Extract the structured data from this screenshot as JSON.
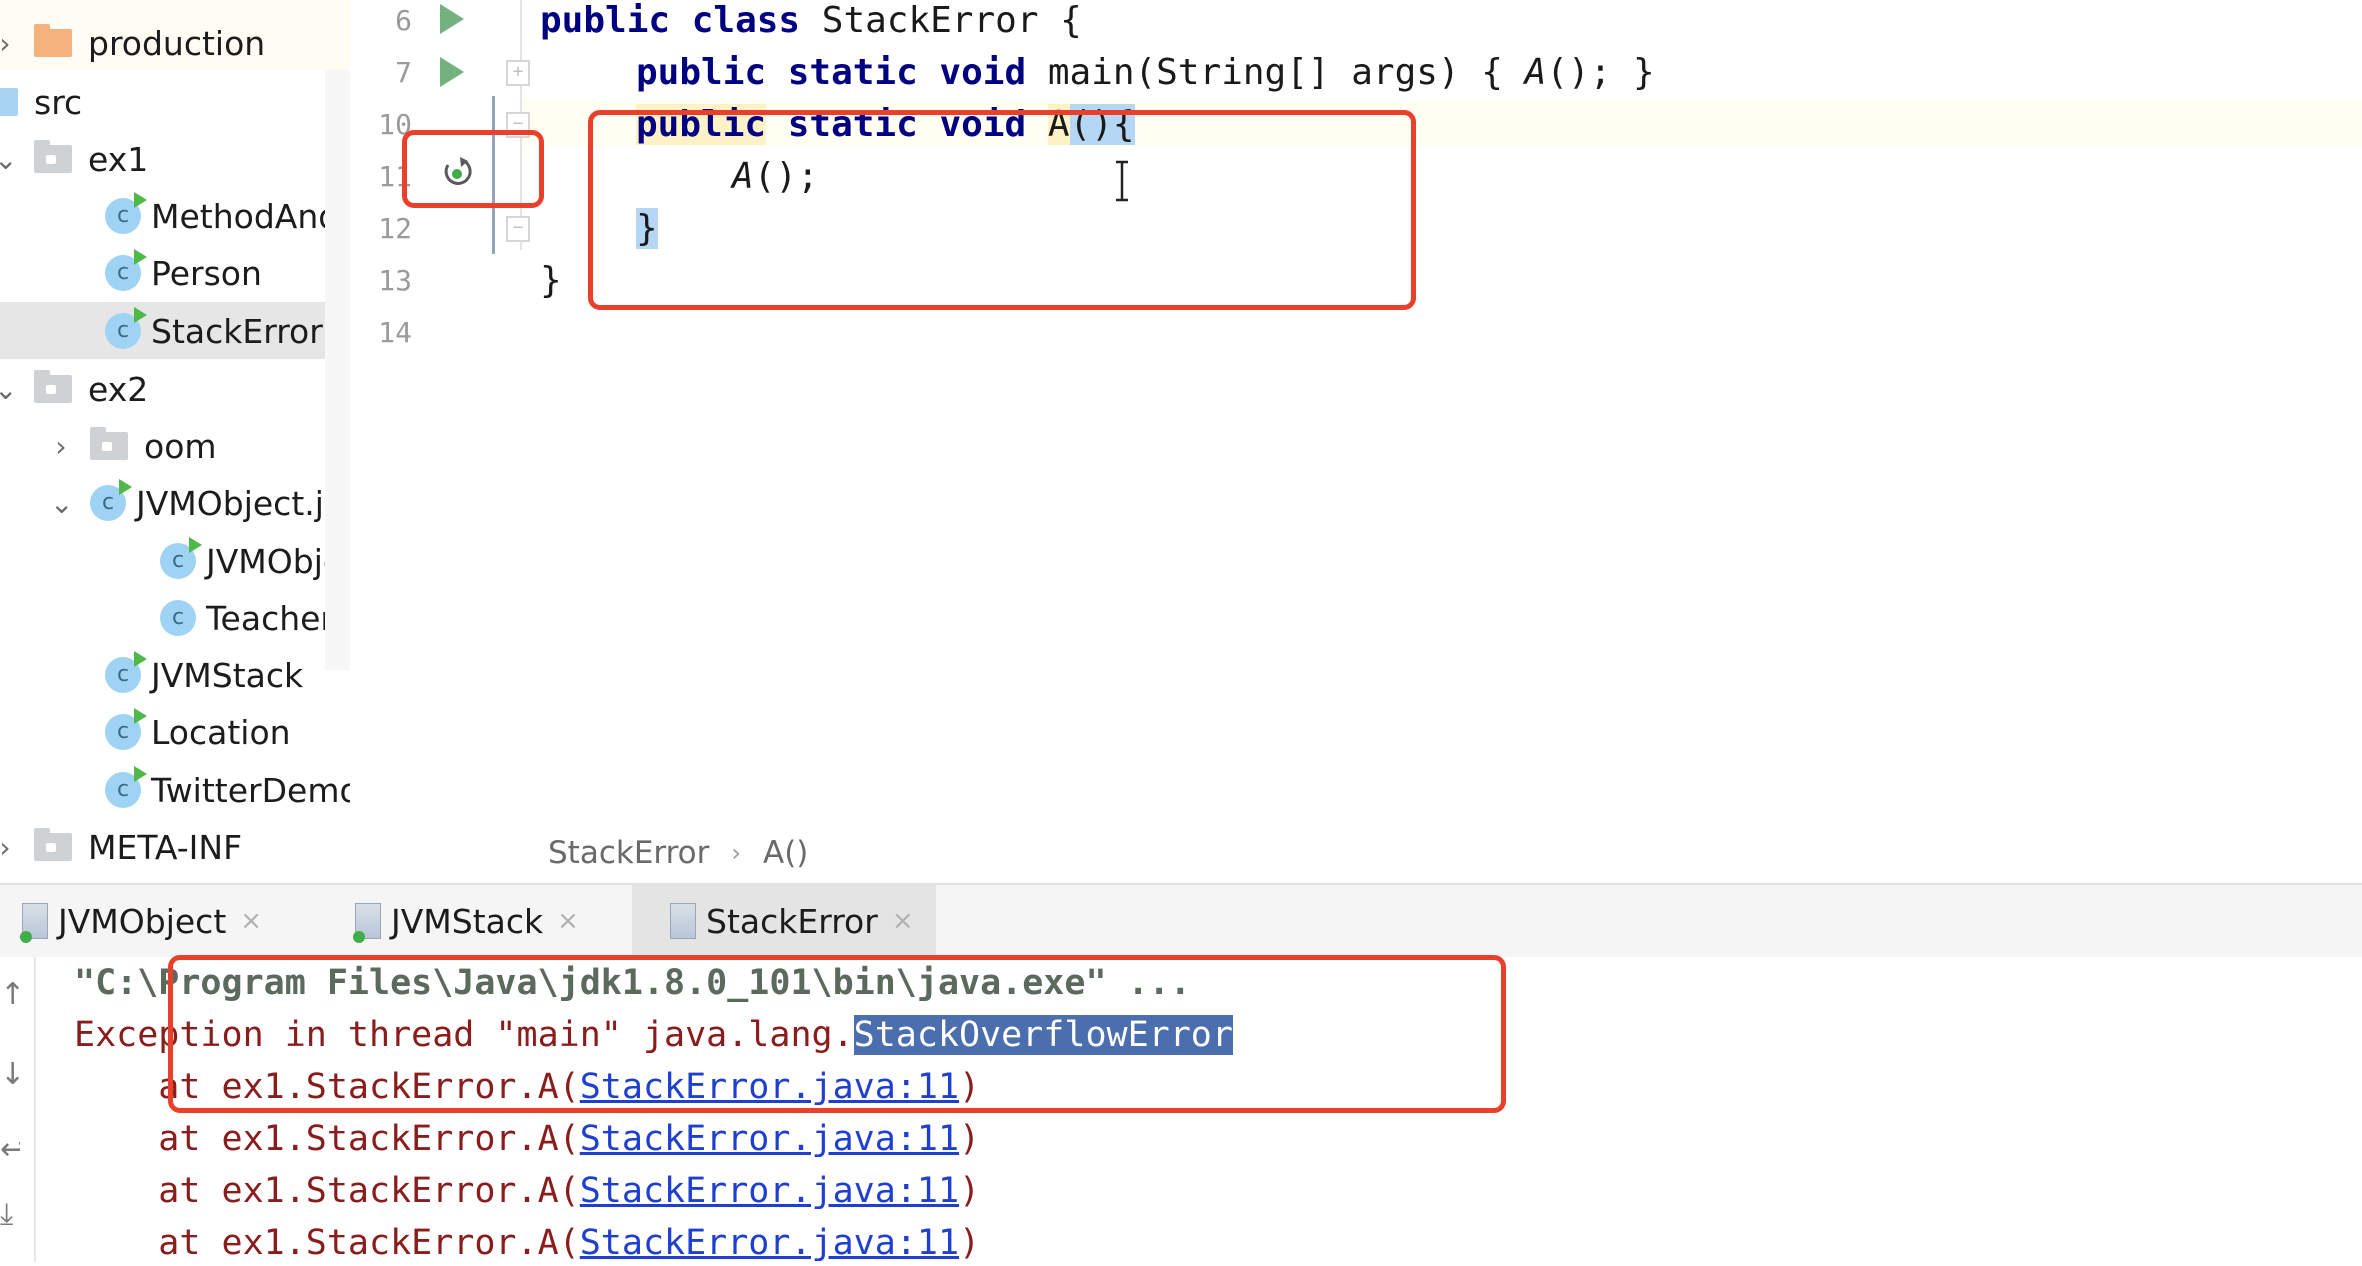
{
  "project_tree": {
    "items": [
      {
        "label": "production",
        "type": "folder-orange",
        "expanded": false
      },
      {
        "label": "src",
        "type": "folder-blue"
      },
      {
        "label": "ex1",
        "type": "package",
        "expanded": true
      },
      {
        "label": "MethodAndS",
        "type": "class-runnable"
      },
      {
        "label": "Person",
        "type": "class-runnable"
      },
      {
        "label": "StackError",
        "type": "class-runnable",
        "selected": true
      },
      {
        "label": "ex2",
        "type": "package",
        "expanded": true
      },
      {
        "label": "oom",
        "type": "package",
        "expanded": false
      },
      {
        "label": "JVMObject.ja",
        "type": "class-runnable",
        "expanded": true
      },
      {
        "label": "JVMObje",
        "type": "class-runnable"
      },
      {
        "label": "Teacher",
        "type": "class"
      },
      {
        "label": "JVMStack",
        "type": "class-runnable"
      },
      {
        "label": "Location",
        "type": "class-runnable"
      },
      {
        "label": "TwitterDemo",
        "type": "class-runnable"
      },
      {
        "label": "META-INF",
        "type": "package",
        "expanded": false
      }
    ]
  },
  "editor": {
    "line_numbers": [
      "6",
      "7",
      "10",
      "11",
      "12",
      "13",
      "14"
    ],
    "lines": {
      "l6": {
        "kw": "public class",
        "rest": " StackError {"
      },
      "l7": {
        "kw": "public static void",
        "rest": " main(String[] args) { ",
        "call": "A",
        "tail": "(); }"
      },
      "l10": {
        "kw1": "public",
        "kw2": " static void",
        "name": "A",
        "brace": "(){"
      },
      "l11": {
        "call": "A",
        "tail": "();"
      },
      "l12": {
        "brace": "}"
      },
      "l13": {
        "brace": "}"
      }
    },
    "breadcrumb": [
      "StackError",
      "A()"
    ],
    "breadcrumb_sep": "›"
  },
  "tabs": [
    {
      "label": "JVMObject",
      "close": "×",
      "active": false
    },
    {
      "label": "JVMStack",
      "close": "×",
      "active": false
    },
    {
      "label": "StackError",
      "close": "×",
      "active": true
    }
  ],
  "console": {
    "command": "\"C:\\Program Files\\Java\\jdk1.8.0_101\\bin\\java.exe\" ...",
    "exception_prefix": "Exception in thread \"main\" java.lang.",
    "exception_class": "StackOverflowError",
    "stack": [
      {
        "prefix": "    at ex1.StackError.A(",
        "link": "StackError.java:11",
        "suffix": ")"
      },
      {
        "prefix": "    at ex1.StackError.A(",
        "link": "StackError.java:11",
        "suffix": ")"
      },
      {
        "prefix": "    at ex1.StackError.A(",
        "link": "StackError.java:11",
        "suffix": ")"
      },
      {
        "prefix": "    at ex1.StackError.A(",
        "link": "StackError.java:11",
        "suffix": ")"
      }
    ],
    "toolbar_icons": [
      "up-arrow",
      "down-arrow",
      "soft-wrap",
      "scroll-to-end"
    ]
  },
  "colors": {
    "annotation_red": "#e8402b",
    "keyword": "#000080",
    "error_text": "#8a1c1c",
    "link": "#1f3fd1",
    "selection": "#4b6eaf"
  }
}
